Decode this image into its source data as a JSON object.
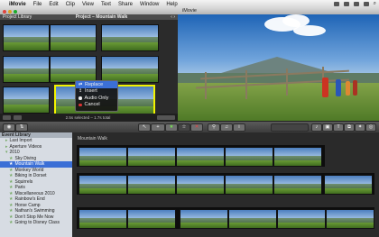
{
  "menubar": {
    "app": "iMovie",
    "items": [
      "File",
      "Edit",
      "Clip",
      "View",
      "Text",
      "Share",
      "Window",
      "Help"
    ]
  },
  "window": {
    "title": "iMovie"
  },
  "project": {
    "library_label": "Project Library",
    "title": "Project – Mountain Walk"
  },
  "context_menu": {
    "items": [
      {
        "label": "Replace",
        "icon": "replace-icon",
        "selected": true
      },
      {
        "label": "Insert",
        "icon": "insert-icon",
        "selected": false
      },
      {
        "label": "Audio Only",
        "icon": "audio-icon",
        "selected": false
      },
      {
        "label": "Cancel",
        "icon": "cancel-icon",
        "selected": false
      }
    ]
  },
  "project_status": "2.5s selected – 1.7s total",
  "event_library": {
    "header": "Event Library",
    "items": [
      {
        "label": "Last Import",
        "level": 0,
        "selected": false
      },
      {
        "label": "Aperture Videos",
        "level": 0,
        "selected": false
      },
      {
        "label": "2010",
        "level": 0,
        "selected": false
      },
      {
        "label": "Sky Diving",
        "level": 1,
        "selected": false
      },
      {
        "label": "Mountain Walk",
        "level": 1,
        "selected": true
      },
      {
        "label": "Monkey World",
        "level": 1,
        "selected": false
      },
      {
        "label": "Biking in Dorset",
        "level": 1,
        "selected": false
      },
      {
        "label": "Squirrels",
        "level": 1,
        "selected": false
      },
      {
        "label": "Paris",
        "level": 1,
        "selected": false
      },
      {
        "label": "Miscellaneous 2010",
        "level": 1,
        "selected": false
      },
      {
        "label": "Rainbow's End",
        "level": 1,
        "selected": false
      },
      {
        "label": "Horse Camp",
        "level": 1,
        "selected": false
      },
      {
        "label": "Nathan's Swimming",
        "level": 1,
        "selected": false
      },
      {
        "label": "Don't Stop Me Now",
        "level": 1,
        "selected": false
      },
      {
        "label": "Going to Disney Class",
        "level": 1,
        "selected": false
      }
    ]
  },
  "event_browser": {
    "title": "Mountain Walk"
  },
  "colors": {
    "selection": "#3b6fd6",
    "clip_border": "#f2f200"
  }
}
